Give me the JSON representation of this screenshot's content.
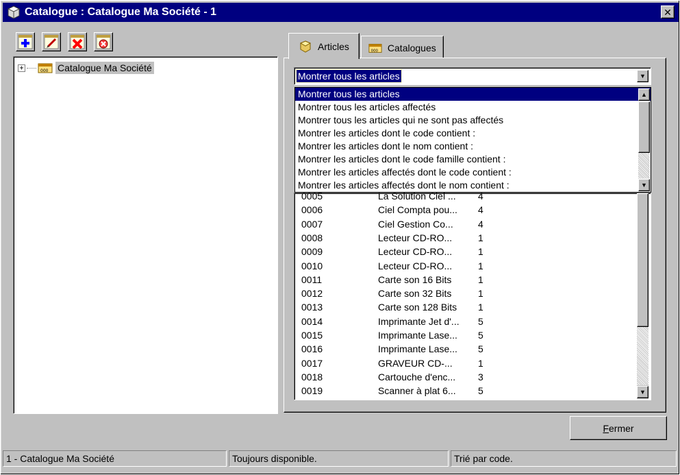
{
  "window": {
    "title": "Catalogue : Catalogue Ma Société - 1",
    "close_glyph": "✕",
    "title_bar_color": "#000080",
    "background_color": "#c0c0c0"
  },
  "toolbar": {
    "buttons": [
      {
        "icon": "add-icon",
        "color": "#0000ff"
      },
      {
        "icon": "edit-icon",
        "color": "#c00000"
      },
      {
        "icon": "delete-icon",
        "color": "#ff0000"
      },
      {
        "icon": "cancel-icon",
        "color": "#ff0000"
      }
    ]
  },
  "tree": {
    "expander": "+",
    "root_label": "Catalogue Ma Société",
    "root_icon": "catalogue-icon"
  },
  "tabs": [
    {
      "label": "Articles",
      "icon": "cube-icon",
      "active": true
    },
    {
      "label": "Catalogues",
      "icon": "catalogue-icon",
      "active": false
    }
  ],
  "filter": {
    "selected": "Montrer tous les articles",
    "options": [
      "Montrer tous les articles",
      "Montrer tous les articles affectés",
      "Montrer tous les articles qui ne sont pas affectés",
      "Montrer les articles dont le code contient :",
      "Montrer les articles dont le nom contient :",
      "Montrer les articles dont le code famille contient :",
      "Montrer les articles affectés dont le code contient :",
      "Montrer les articles affectés dont le nom contient :"
    ]
  },
  "articles": [
    {
      "code": "0005",
      "name": "La Solution Ciel ...",
      "qty": "4"
    },
    {
      "code": "0006",
      "name": "Ciel Compta pou...",
      "qty": "4"
    },
    {
      "code": "0007",
      "name": "Ciel Gestion Co...",
      "qty": "4"
    },
    {
      "code": "0008",
      "name": "Lecteur CD-RO...",
      "qty": "1"
    },
    {
      "code": "0009",
      "name": "Lecteur CD-RO...",
      "qty": "1"
    },
    {
      "code": "0010",
      "name": "Lecteur CD-RO...",
      "qty": "1"
    },
    {
      "code": "0011",
      "name": "Carte son 16 Bits",
      "qty": "1"
    },
    {
      "code": "0012",
      "name": "Carte son 32 Bits",
      "qty": "1"
    },
    {
      "code": "0013",
      "name": "Carte son 128 Bits",
      "qty": "1"
    },
    {
      "code": "0014",
      "name": "Imprimante Jet d'...",
      "qty": "5"
    },
    {
      "code": "0015",
      "name": "Imprimante Lase...",
      "qty": "5"
    },
    {
      "code": "0016",
      "name": "Imprimante Lase...",
      "qty": "5"
    },
    {
      "code": "0017",
      "name": "GRAVEUR CD-...",
      "qty": "1"
    },
    {
      "code": "0018",
      "name": "Cartouche d'enc...",
      "qty": "3"
    },
    {
      "code": "0019",
      "name": "Scanner à plat 6...",
      "qty": "5"
    }
  ],
  "buttons": {
    "close_first": "F",
    "close_rest": "ermer"
  },
  "status": {
    "catalogue": "1 - Catalogue Ma Société",
    "availability": "Toujours disponible.",
    "sort": "Trié par code."
  }
}
